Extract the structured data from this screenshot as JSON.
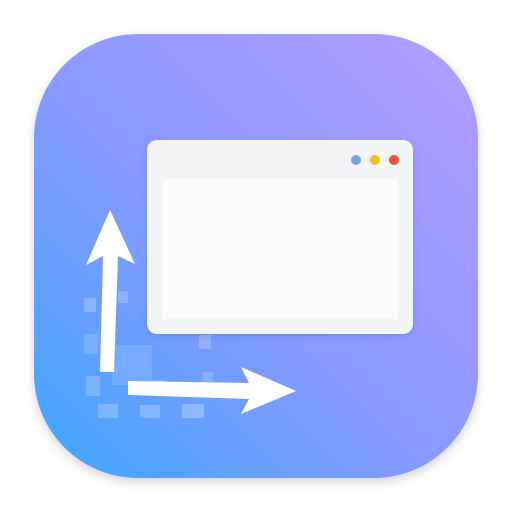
{
  "app_icon": {
    "name": "window-resize-app-icon",
    "gradient": {
      "top_right": "#b59cff",
      "middle": "#8799ff",
      "bottom_left": "#3da7ff"
    },
    "window": {
      "frame_color": "#f3f4f6",
      "content_color": "#fbfbfc",
      "traffic_lights": [
        {
          "name": "blue-dot",
          "color": "#6aa8e6"
        },
        {
          "name": "yellow-dot",
          "color": "#f6c21a"
        },
        {
          "name": "red-dot",
          "color": "#f0502d"
        }
      ]
    },
    "arrows": {
      "color": "#ffffff",
      "directions": [
        "up",
        "right"
      ]
    }
  }
}
